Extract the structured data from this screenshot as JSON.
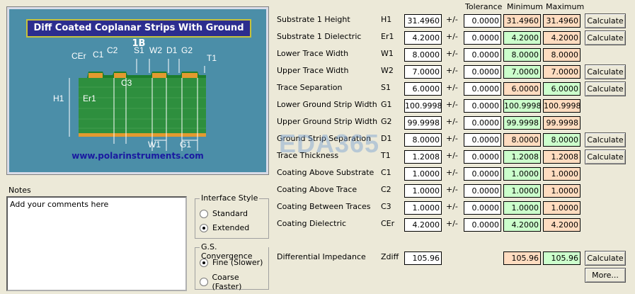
{
  "diagram": {
    "title": "Diff Coated Coplanar Strips With Ground  1B",
    "url": "www.polarinstruments.com",
    "labels": {
      "cer": "CEr",
      "c1": "C1",
      "c2": "C2",
      "s1": "S1",
      "w2": "W2",
      "d1": "D1",
      "g2": "G2",
      "t1": "T1",
      "c3": "C3",
      "h1": "H1",
      "er1": "Er1",
      "w1": "W1",
      "g1": "G1"
    }
  },
  "notes": {
    "label": "Notes",
    "text": "Add your comments here"
  },
  "interface_style": {
    "title": "Interface Style",
    "options": [
      {
        "label": "Standard",
        "selected": false
      },
      {
        "label": "Extended",
        "selected": true
      }
    ]
  },
  "gs_convergence": {
    "title": "G.S. Convergence",
    "options": [
      {
        "label": "Fine (Slower)",
        "selected": true
      },
      {
        "label": "Coarse (Faster)",
        "selected": false
      }
    ]
  },
  "headers": {
    "tolerance": "Tolerance",
    "minimum": "Minimum",
    "maximum": "Maximum"
  },
  "pm_symbol": "+/-",
  "colors": {
    "min_green": "#ccffcc",
    "max_orange": "#ffdcc0"
  },
  "rows": [
    {
      "label": "Substrate 1 Height",
      "sym": "H1",
      "value": "31.4960",
      "tol": "0.0000",
      "min": "31.4960",
      "max": "31.4960",
      "min_color": "orange",
      "max_color": "orange",
      "button": "Calculate"
    },
    {
      "label": "Substrate 1 Dielectric",
      "sym": "Er1",
      "value": "4.2000",
      "tol": "0.0000",
      "min": "4.2000",
      "max": "4.2000",
      "min_color": "green",
      "max_color": "orange",
      "button": "Calculate"
    },
    {
      "label": "Lower Trace Width",
      "sym": "W1",
      "value": "8.0000",
      "tol": "0.0000",
      "min": "8.0000",
      "max": "8.0000",
      "min_color": "green",
      "max_color": "orange",
      "button": ""
    },
    {
      "label": "Upper Trace Width",
      "sym": "W2",
      "value": "7.0000",
      "tol": "0.0000",
      "min": "7.0000",
      "max": "7.0000",
      "min_color": "green",
      "max_color": "orange",
      "button": "Calculate"
    },
    {
      "label": "Trace Separation",
      "sym": "S1",
      "value": "6.0000",
      "tol": "0.0000",
      "min": "6.0000",
      "max": "6.0000",
      "min_color": "orange",
      "max_color": "green",
      "button": "Calculate"
    },
    {
      "label": "Lower Ground Strip Width",
      "sym": "G1",
      "value": "100.9998",
      "tol": "0.0000",
      "min": "100.9998",
      "max": "100.9998",
      "min_color": "green",
      "max_color": "orange",
      "button": ""
    },
    {
      "label": "Upper Ground Strip Width",
      "sym": "G2",
      "value": "99.9998",
      "tol": "0.0000",
      "min": "99.9998",
      "max": "99.9998",
      "min_color": "green",
      "max_color": "orange",
      "button": ""
    },
    {
      "label": "Ground Strip Separation",
      "sym": "D1",
      "value": "8.0000",
      "tol": "0.0000",
      "min": "8.0000",
      "max": "8.0000",
      "min_color": "orange",
      "max_color": "green",
      "button": "Calculate"
    },
    {
      "label": "Trace Thickness",
      "sym": "T1",
      "value": "1.2008",
      "tol": "0.0000",
      "min": "1.2008",
      "max": "1.2008",
      "min_color": "green",
      "max_color": "orange",
      "button": "Calculate"
    },
    {
      "label": "Coating Above Substrate",
      "sym": "C1",
      "value": "1.0000",
      "tol": "0.0000",
      "min": "1.0000",
      "max": "1.0000",
      "min_color": "green",
      "max_color": "orange",
      "button": ""
    },
    {
      "label": "Coating Above Trace",
      "sym": "C2",
      "value": "1.0000",
      "tol": "0.0000",
      "min": "1.0000",
      "max": "1.0000",
      "min_color": "green",
      "max_color": "orange",
      "button": ""
    },
    {
      "label": "Coating Between Traces",
      "sym": "C3",
      "value": "1.0000",
      "tol": "0.0000",
      "min": "1.0000",
      "max": "1.0000",
      "min_color": "green",
      "max_color": "orange",
      "button": ""
    },
    {
      "label": "Coating Dielectric",
      "sym": "CEr",
      "value": "4.2000",
      "tol": "0.0000",
      "min": "4.2000",
      "max": "4.2000",
      "min_color": "green",
      "max_color": "orange",
      "button": ""
    }
  ],
  "impedance": {
    "label": "Differential Impedance",
    "sym": "Zdiff",
    "value": "105.96",
    "min": "105.96",
    "max": "105.96",
    "button": "Calculate"
  },
  "more_button": "More...",
  "watermark": "EDA365"
}
